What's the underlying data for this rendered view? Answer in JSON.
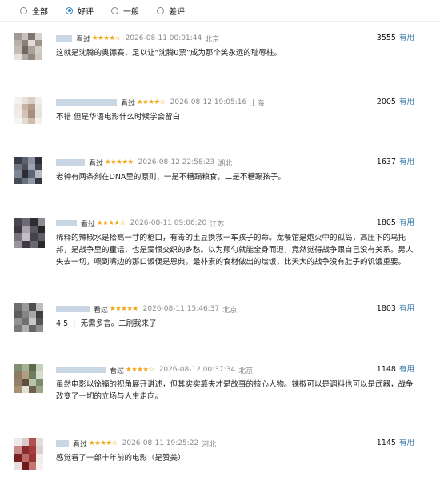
{
  "filter": {
    "options": [
      {
        "label": "全部",
        "checked": false
      },
      {
        "label": "好评",
        "checked": true
      },
      {
        "label": "一般",
        "checked": false
      },
      {
        "label": "差评",
        "checked": false
      }
    ]
  },
  "colors": {
    "accent": "#2e82c8",
    "star": "#f2a30f",
    "link": "#3377aa"
  },
  "reviews": [
    {
      "status": "看过",
      "stars": "★★★★☆",
      "time": "2026-08-11 00:01:44",
      "location": "北京",
      "votes": "3555",
      "useful_label": "有用",
      "content": "这就是沈腾的奥德赛，足以让“沈腾0票”成为那个笑永远的耻辱柱。"
    },
    {
      "status": "看过",
      "stars": "★★★★☆",
      "time": "2026-08-12 19:05:16",
      "location": "上海",
      "votes": "2005",
      "useful_label": "有用",
      "content": "不错 但是华语电影什么时候学会留白"
    },
    {
      "status": "看过",
      "stars": "★★★★★",
      "time": "2026-08-12 22:58:23",
      "location": "湖北",
      "votes": "1637",
      "useful_label": "有用",
      "content": "老钟有两条刻在DNA里的原则，一是不糟蹋粮食，二是不糟蹋孩子。"
    },
    {
      "status": "看过",
      "stars": "★★★★☆",
      "time": "2026-08-11 09:06:20",
      "location": "江苏",
      "votes": "1805",
      "useful_label": "有用",
      "content": "稀释的辣椒水是拾高一寸的枪口，有毒的土豆换救一车孩子的命。龙餐馆是炮火中的孤岛，高压下的乌托邦，是战争里的童话，也是爱恨交织的乡愁。以为颠勺就能全身而退，竟然觉得战争跟自己没有关系。男人失去一切，喂到嘴边的那口饭便是恩典。最朴素的食材做出的烩饭，比天大的战争没有肚子的饥饿重要。"
    },
    {
      "status": "看过",
      "stars": "★★★★★",
      "time": "2026-08-11 15:46:37",
      "location": "北京",
      "votes": "1803",
      "useful_label": "有用",
      "content": "4.5 ｜ 无需多言。二刷我来了"
    },
    {
      "status": "看过",
      "stars": "★★★★☆",
      "time": "2026-08-12 00:37:34",
      "location": "北京",
      "votes": "1148",
      "useful_label": "有用",
      "content": "虽然电影以徐福的视角展开讲述，但其实实篡夫才是故事的核心人物。辣椒可以是调料也可以是武器，战争改变了一切的立场与人生走向。"
    },
    {
      "status": "看过",
      "stars": "★★★★☆",
      "time": "2026-08-11 19:25:22",
      "location": "河北",
      "votes": "1145",
      "useful_label": "有用",
      "content": "感觉看了一部十年前的电影（是赞美）"
    }
  ]
}
